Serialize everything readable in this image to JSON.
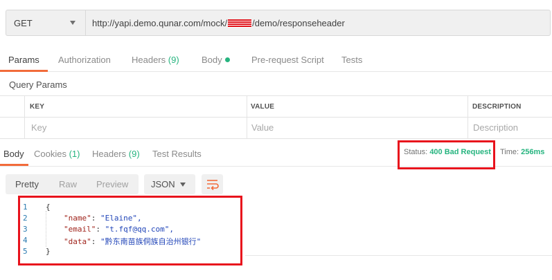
{
  "request": {
    "method": "GET",
    "url_prefix": "http://yapi.demo.qunar.com/mock/",
    "url_suffix": "/demo/responseheader"
  },
  "request_tabs": [
    {
      "label": "Params",
      "active": true
    },
    {
      "label": "Authorization"
    },
    {
      "label": "Headers",
      "count": "(9)"
    },
    {
      "label": "Body",
      "dot": true
    },
    {
      "label": "Pre-request Script"
    },
    {
      "label": "Tests"
    }
  ],
  "query_params": {
    "title": "Query Params",
    "headers": [
      "KEY",
      "VALUE",
      "DESCRIPTION"
    ],
    "placeholders": [
      "Key",
      "Value",
      "Description"
    ]
  },
  "response_tabs": [
    {
      "label": "Body",
      "active": true
    },
    {
      "label": "Cookies",
      "count": "(1)"
    },
    {
      "label": "Headers",
      "count": "(9)"
    },
    {
      "label": "Test Results"
    }
  ],
  "status": {
    "label": "Status:",
    "value": "400 Bad Request"
  },
  "time": {
    "label": "Time:",
    "value": "256ms"
  },
  "view_modes": [
    "Pretty",
    "Raw",
    "Preview"
  ],
  "format": "JSON",
  "wrap_icon": "wrap-lines-icon",
  "code_lines": [
    {
      "n": "1",
      "text": "{"
    },
    {
      "n": "2",
      "key": "\"name\"",
      "value": "\"Elaine\","
    },
    {
      "n": "3",
      "key": "\"email\"",
      "value": "\"t.fqf@qq.com\","
    },
    {
      "n": "4",
      "key": "\"data\"",
      "value": "\"黔东南苗族侗族自治州银行\""
    },
    {
      "n": "5",
      "text": "}"
    }
  ],
  "colors": {
    "accent": "#f26b3a",
    "status_green": "#26b47f",
    "highlight_red": "#e8121c"
  }
}
